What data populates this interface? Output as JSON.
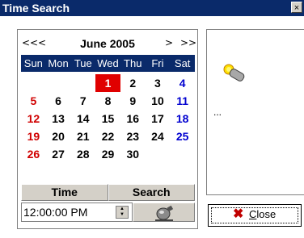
{
  "window": {
    "title": "Time Search",
    "close_glyph": "×"
  },
  "calendar": {
    "nav_prev_year": "<<",
    "nav_prev_month": "<",
    "month_label": "June 2005",
    "nav_next_month": ">",
    "nav_next_year": ">>",
    "weekdays": [
      "Sun",
      "Mon",
      "Tue",
      "Wed",
      "Thu",
      "Fri",
      "Sat"
    ],
    "weeks": [
      [
        "",
        "",
        "",
        "1",
        "2",
        "3",
        "4"
      ],
      [
        "5",
        "6",
        "7",
        "8",
        "9",
        "10",
        "11"
      ],
      [
        "12",
        "13",
        "14",
        "15",
        "16",
        "17",
        "18"
      ],
      [
        "19",
        "20",
        "21",
        "22",
        "23",
        "24",
        "25"
      ],
      [
        "26",
        "27",
        "28",
        "29",
        "30",
        "",
        ""
      ]
    ],
    "selected_day": "1",
    "colors": {
      "header_bg": "#0a2a6a",
      "sunday": "#d00000",
      "saturday": "#0000d0",
      "selected_bg": "#e00000"
    }
  },
  "time_label": "Time",
  "search_label": "Search",
  "time_value": "12:00:00 PM",
  "result_text": "...",
  "close_button": {
    "label": "Close"
  }
}
